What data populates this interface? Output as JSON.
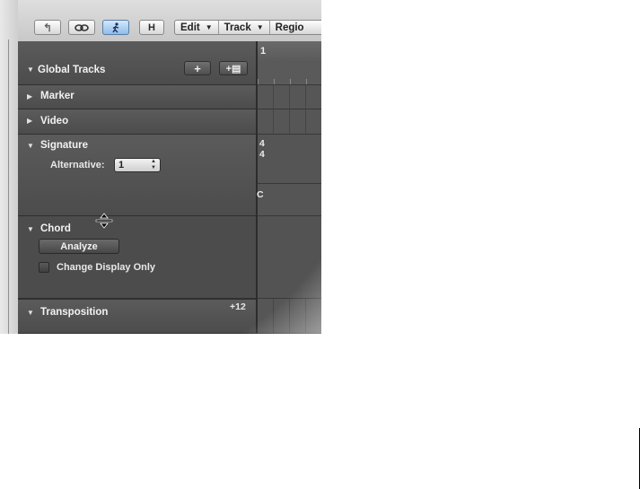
{
  "toolbar": {
    "buttons": [
      {
        "name": "back-arrow-icon",
        "glyph": "↰"
      },
      {
        "name": "link-icon",
        "glyph": "∞"
      },
      {
        "name": "catch-playhead-icon",
        "glyph": "🏃"
      },
      {
        "name": "hide-button",
        "label": "H"
      }
    ],
    "menus": [
      {
        "label": "Edit",
        "arrow": "▼"
      },
      {
        "label": "Track",
        "arrow": "▼"
      },
      {
        "label": "Regio",
        "arrow": ""
      }
    ]
  },
  "global_tracks": {
    "title": "Global Tracks",
    "add_button": "+",
    "add_folder_button": "+▤",
    "rows": {
      "marker": "Marker",
      "video": "Video",
      "signature": "Signature",
      "alternative_label": "Alternative:",
      "alternative_value": "1",
      "chord": "Chord",
      "analyze": "Analyze",
      "change_display_only": "Change Display Only",
      "transposition": "Transposition",
      "transposition_value": "+12"
    }
  },
  "arrange": {
    "ruler_bar": "1",
    "time_sig_top": "4",
    "time_sig_bottom": "4",
    "chord_value": "C"
  },
  "colors": {
    "panel": "#505050",
    "toolbar": "#d2d2d2",
    "catch_button": "#8fbde9"
  }
}
